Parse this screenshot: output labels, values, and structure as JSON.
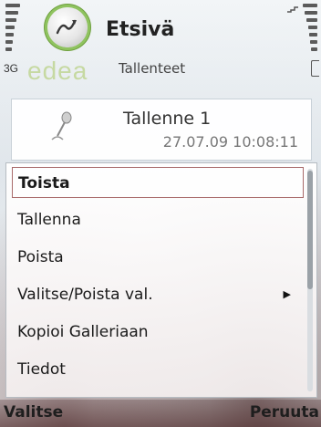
{
  "status": {
    "network": "3G",
    "operator": "edea",
    "signal_level_fraction": 1.0,
    "battery_level_fraction": 1.0
  },
  "header": {
    "title": "Etsivä",
    "subtitle": "Tallenteet",
    "app_icon": "voice-recorder-icon"
  },
  "recording": {
    "name": "Tallenne 1",
    "date": "27.07.09 10:08:11",
    "icon": "microphone-icon"
  },
  "menu": {
    "items": [
      {
        "label": "Toista",
        "selected": true
      },
      {
        "label": "Tallenna"
      },
      {
        "label": "Poista"
      },
      {
        "label": "Valitse/Poista val.",
        "has_submenu": true
      },
      {
        "label": "Kopioi Galleriaan"
      },
      {
        "label": "Tiedot"
      }
    ]
  },
  "softkeys": {
    "left": "Valitse",
    "right": "Peruuta"
  }
}
